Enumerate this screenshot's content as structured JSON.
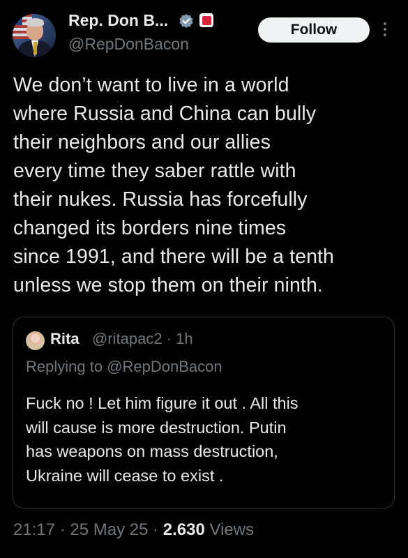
{
  "author": {
    "name": "Rep. Don B...",
    "handle": "@RepDonBacon",
    "follow_label": "Follow"
  },
  "tweet": {
    "lines": [
      "We don’t want to live in a world",
      "where Russia and China can bully",
      "their neighbors and our allies",
      "every time they saber rattle with",
      "their nukes. Russia has forcefully",
      "changed its borders nine times",
      "since 1991, and there will be a tenth",
      "unless we stop them on their ninth."
    ]
  },
  "quote": {
    "name": "Rita",
    "meta": "@ritapac2 · 1h",
    "replying_to": "Replying to @RepDonBacon",
    "lines": [
      "Fuck no ! Let him figure it out . All this",
      "will cause is more destruction. Putin",
      "has weapons on mass destruction,",
      "Ukraine will cease to exist ."
    ]
  },
  "footer": {
    "time_date": "21:17 · 25 May 25 · ",
    "views_count": "2.630",
    "views_label": " Views"
  },
  "colors": {
    "background": "#000000",
    "text": "#e7e9ea",
    "secondary": "#71767b",
    "verified": "#829aab",
    "government_badge": "#d7263d"
  },
  "icons": {
    "verified": "verified-badge-icon",
    "affiliation": "government-affiliation-icon",
    "more": "more-options-icon"
  }
}
